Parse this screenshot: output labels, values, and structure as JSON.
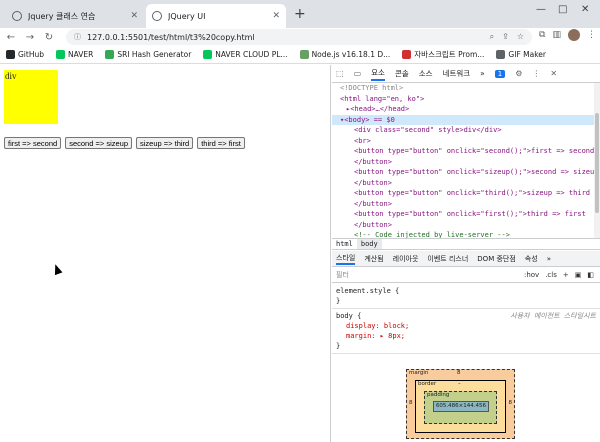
{
  "tabs": [
    {
      "label": "Jquery 클래스 연습"
    },
    {
      "label": "JQuery UI"
    }
  ],
  "window_controls": [
    "—",
    "□",
    "✕"
  ],
  "address": {
    "url": "127.0.0.1:5501/test/html/t3%20copy.html"
  },
  "bookmarks": [
    {
      "label": "GitHub",
      "color": "#24292e"
    },
    {
      "label": "NAVER",
      "color": "#03c75a"
    },
    {
      "label": "SRI Hash Generator",
      "color": "#34a853"
    },
    {
      "label": "NAVER CLOUD PL...",
      "color": "#03c75a"
    },
    {
      "label": "Node.js v16.18.1 D...",
      "color": "#689f63"
    },
    {
      "label": "자바스크립트 Prom...",
      "color": "#d32f2f"
    },
    {
      "label": "GIF Maker",
      "color": "#5f6368"
    }
  ],
  "page": {
    "div_text": "div",
    "buttons": [
      "first => second",
      "second => sizeup",
      "sizeup => third",
      "third => first"
    ]
  },
  "devtools": {
    "tabs": {
      "elements": "요소",
      "console": "콘솔",
      "sources": "소스",
      "network": "네트워크",
      "more": "»",
      "issues": "1"
    },
    "code": [
      "<!DOCTYPE html>",
      "<html lang=\"en, ko\">",
      "▸<head>…</head>",
      "▾<body> == $0",
      "<div class=\"second\" style>div</div>",
      "<br>",
      "<button type=\"button\" onclick=\"second();\">first => second",
      "</button>",
      "<button type=\"button\" onclick=\"sizeup();\">second => sizeup",
      "</button>",
      "<button type=\"button\" onclick=\"third();\">sizeup => third",
      "</button>",
      "<button type=\"button\" onclick=\"first();\">third => first",
      "</button>",
      "<!-- Code injected by live-server -->"
    ],
    "breadcrumbs": [
      "html",
      "body"
    ],
    "subtabs": [
      "스타일",
      "계산됨",
      "레이아웃",
      "이벤트 리스너",
      "DOM 중단점",
      "속성",
      "»"
    ],
    "filter_placeholder": "필터",
    "filter_tools": [
      ":hov",
      ".cls",
      "+"
    ],
    "rules": {
      "element_style": "element.style {",
      "close": "}",
      "body_selector": "body {",
      "ua_label": "사용자 에이전트 스타일시트",
      "display": "display: block;",
      "margin": "margin: ▸ 8px;"
    },
    "box": {
      "margin": "margin",
      "margin_val": "8",
      "border": "border",
      "border_val": "–",
      "padding": "padding",
      "padding_val": "–",
      "content": "605.486×144.456",
      "side": "8"
    }
  }
}
